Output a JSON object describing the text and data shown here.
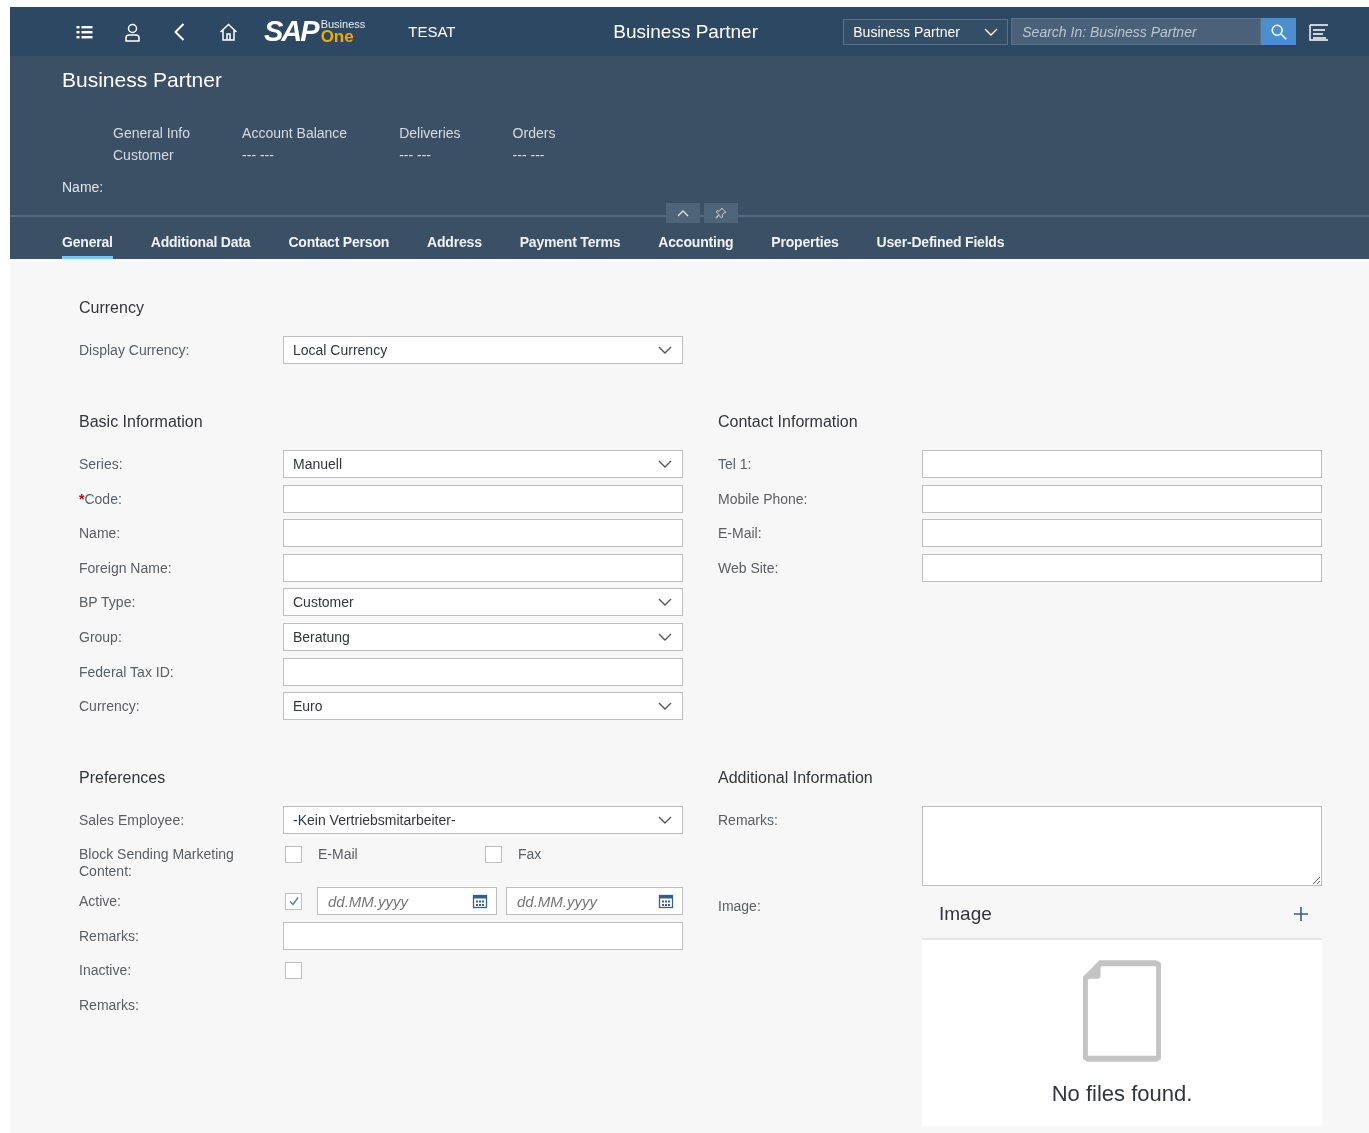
{
  "shell": {
    "logo": {
      "main": "SAP",
      "top": "Business",
      "bottom": "One"
    },
    "system": "TESAT",
    "title": "Business Partner",
    "scope": "Business Partner",
    "search": {
      "placeholder": "Search In: Business Partner"
    }
  },
  "header": {
    "title": "Business Partner",
    "kpis": [
      {
        "label": "General Info",
        "value": "Customer"
      },
      {
        "label": "Account Balance",
        "value": "--- ---"
      },
      {
        "label": "Deliveries",
        "value": "--- ---"
      },
      {
        "label": "Orders",
        "value": "--- ---"
      }
    ],
    "name_label": "Name:"
  },
  "tabs": [
    {
      "label": "General",
      "selected": true
    },
    {
      "label": "Additional Data",
      "selected": false
    },
    {
      "label": "Contact Person",
      "selected": false
    },
    {
      "label": "Address",
      "selected": false
    },
    {
      "label": "Payment Terms",
      "selected": false
    },
    {
      "label": "Accounting",
      "selected": false
    },
    {
      "label": "Properties",
      "selected": false
    },
    {
      "label": "User-Defined Fields",
      "selected": false
    }
  ],
  "sections": [
    [
      {
        "title": "Currency",
        "fields": [
          {
            "kind": "select",
            "label": "Display Currency:",
            "value": "Local Currency"
          }
        ]
      }
    ],
    [
      {
        "title": "Basic Information",
        "fields": [
          {
            "kind": "select",
            "label": "Series:",
            "value": "Manuell"
          },
          {
            "kind": "text",
            "label": "Code:",
            "required_mark": "*"
          },
          {
            "kind": "text",
            "label": "Name:"
          },
          {
            "kind": "text",
            "label": "Foreign Name:"
          },
          {
            "kind": "select",
            "label": "BP Type:",
            "value": "Customer"
          },
          {
            "kind": "select",
            "label": "Group:",
            "value": "Beratung"
          },
          {
            "kind": "text",
            "label": "Federal Tax ID:"
          },
          {
            "kind": "select",
            "label": "Currency:",
            "value": "Euro"
          }
        ]
      },
      {
        "title": "Contact Information",
        "fields": [
          {
            "kind": "text",
            "label": "Tel 1:"
          },
          {
            "kind": "text",
            "label": "Mobile Phone:"
          },
          {
            "kind": "text",
            "label": "E-Mail:"
          },
          {
            "kind": "text",
            "label": "Web Site:"
          }
        ]
      }
    ],
    [
      {
        "title": "Preferences",
        "fields": [
          {
            "kind": "select",
            "label": "Sales Employee:",
            "value": "-Kein Vertriebsmitarbeiter-"
          },
          {
            "kind": "checks",
            "label": "Block Sending Marketing Content:",
            "items": [
              {
                "label": "E-Mail",
                "checked": false
              },
              {
                "label": "Fax",
                "checked": false
              }
            ]
          },
          {
            "kind": "check_dates",
            "label": "Active:",
            "checked": true,
            "dates": [
              {
                "placeholder": "dd.MM.yyyy"
              },
              {
                "placeholder": "dd.MM.yyyy"
              }
            ]
          },
          {
            "kind": "text",
            "label": "Remarks:"
          },
          {
            "kind": "checkbox",
            "label": "Inactive:",
            "checked": false
          },
          {
            "kind": "none",
            "label": "Remarks:"
          }
        ]
      },
      {
        "title": "Additional Information",
        "fields": [
          {
            "kind": "textarea",
            "label": "Remarks:"
          },
          {
            "kind": "image",
            "label": "Image:",
            "panel_title": "Image",
            "empty_text": "No files found."
          }
        ]
      }
    ]
  ]
}
